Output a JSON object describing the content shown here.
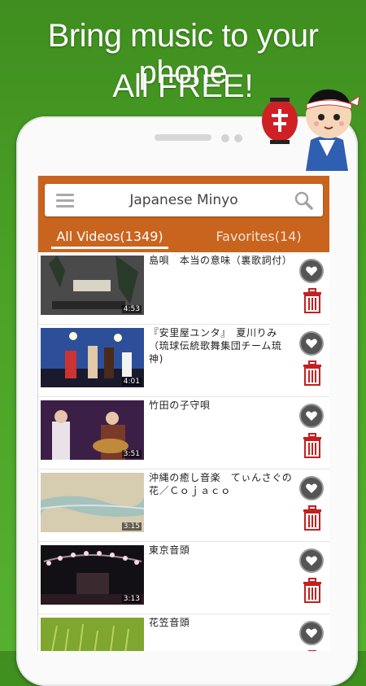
{
  "promo": {
    "line1": "Bring music to your phone",
    "line2": "All FREE!"
  },
  "app": {
    "search_title": "Japanese Minyo",
    "tabs": [
      {
        "label": "All Videos(1349)",
        "active": true
      },
      {
        "label": "Favorites(14)",
        "active": false
      }
    ],
    "accent_color": "#c9641f"
  },
  "videos": [
    {
      "title": "島唄　本当の意味（裏歌詞付）",
      "duration": "4:53"
    },
    {
      "title": "『安里屋ユンタ』　夏川りみ（琉球伝統歌舞集団チーム琉神)",
      "duration": "4:01"
    },
    {
      "title": "竹田の子守唄",
      "duration": "3:51"
    },
    {
      "title": "沖縄の癒し音楽　てぃんさぐの花／Ｃｏｊａｃｏ",
      "duration": "3:15"
    },
    {
      "title": "東京音頭",
      "duration": "3:13"
    },
    {
      "title": "花笠音頭",
      "duration": ""
    }
  ],
  "icons": {
    "menu": "menu-icon",
    "search": "search-icon",
    "favorite": "heart-icon",
    "delete": "trash-icon"
  }
}
